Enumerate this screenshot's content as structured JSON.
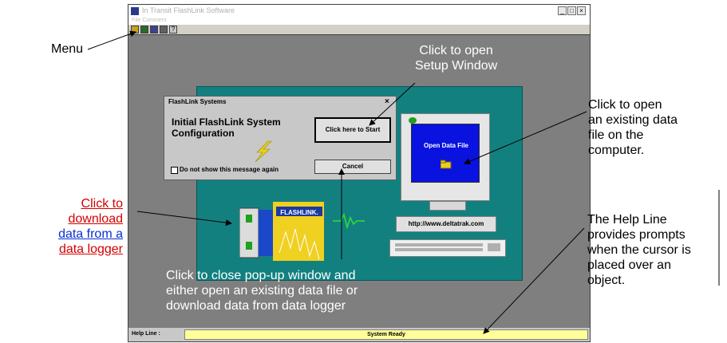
{
  "window": {
    "title": "In Transit FlashLink Software",
    "menu": "File  Comment",
    "min_glyph": "_",
    "max_glyph": "□",
    "close_glyph": "×"
  },
  "toolbar": {
    "help_glyph": "?"
  },
  "dialog": {
    "title": "FlashLink Systems",
    "close_glyph": "×",
    "heading_line1": "Initial FlashLink System",
    "heading_line2": "Configuration",
    "start_button": "Click here to Start",
    "checkbox_label": "Do not show this message again",
    "cancel_button": "Cancel"
  },
  "monitor": {
    "screen_label": "Open Data File",
    "url": "http://www.deltatrak.com"
  },
  "logger": {
    "brand": "FLASHLINK."
  },
  "status": {
    "help_label": "Help Line :",
    "help_text": "System Ready"
  },
  "annotations": {
    "menu": "Menu",
    "setup_line1": "Click to open",
    "setup_line2": "Setup Window",
    "file_line1": "Click to open",
    "file_line2": "an existing data",
    "file_line3": "file on the",
    "file_line4": "computer.",
    "download_line1": "Click to",
    "download_line2": "download",
    "download_line3": "data from a",
    "download_line4": "data logger",
    "close_line1": "Click to close pop-up window and",
    "close_line2": "either open an existing data file or",
    "close_line3": "download data from data logger",
    "help_line1": "The Help Line",
    "help_line2": "provides prompts",
    "help_line3": "when the cursor is",
    "help_line4": "placed over an",
    "help_line5": "object."
  },
  "colors": {
    "panel": "#138080",
    "screen": "#0a12e0",
    "help_line_bg": "#ffff99",
    "link_red": "#d40000",
    "link_blue": "#0b2fd0"
  }
}
